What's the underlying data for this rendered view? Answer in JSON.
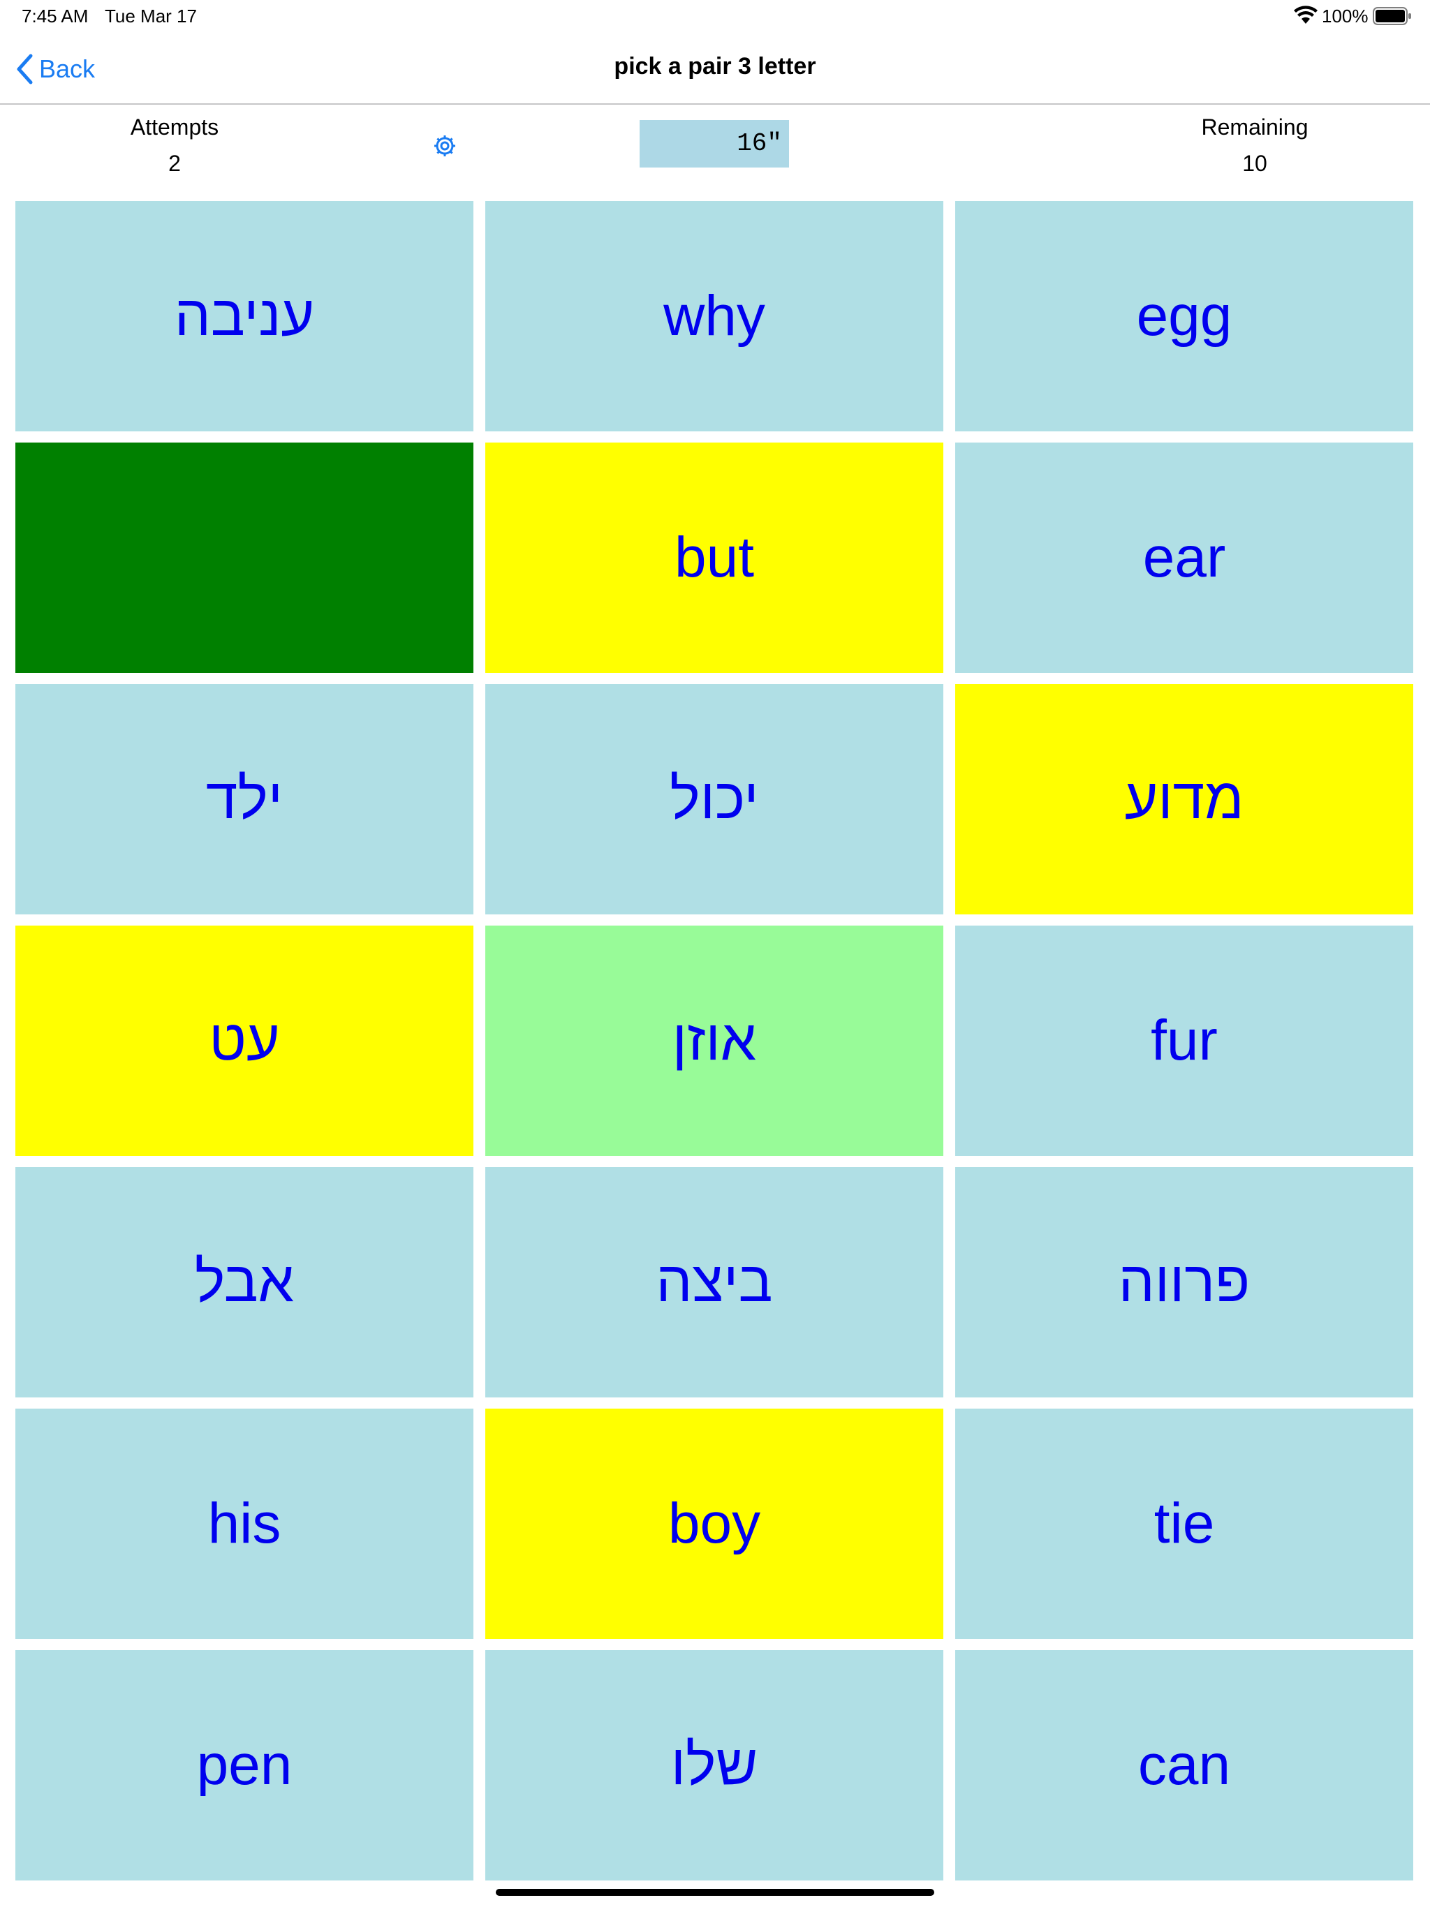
{
  "status_bar": {
    "time": "7:45 AM",
    "date": "Tue Mar 17",
    "battery": "100%"
  },
  "nav": {
    "back_label": "Back",
    "title": "pick a pair 3 letter"
  },
  "stats": {
    "attempts_label": "Attempts",
    "attempts_value": "2",
    "remaining_label": "Remaining",
    "remaining_value": "10"
  },
  "timer": "16\"",
  "colors": {
    "unselected": "#b0dfe5",
    "selected": "#ffff00",
    "matched": "#008000",
    "hint": "#98fb98",
    "text": "#0000ee",
    "accent": "#1a7cf2"
  },
  "cards": [
    {
      "text": "עניבה",
      "state": "unselected"
    },
    {
      "text": "why",
      "state": "unselected"
    },
    {
      "text": "egg",
      "state": "unselected"
    },
    {
      "text": "",
      "state": "matched"
    },
    {
      "text": "but",
      "state": "selected"
    },
    {
      "text": "ear",
      "state": "unselected"
    },
    {
      "text": "ילד",
      "state": "unselected"
    },
    {
      "text": "יכול",
      "state": "unselected"
    },
    {
      "text": "מדוע",
      "state": "selected"
    },
    {
      "text": "עט",
      "state": "selected"
    },
    {
      "text": "אוזן",
      "state": "hint"
    },
    {
      "text": "fur",
      "state": "unselected"
    },
    {
      "text": "אבל",
      "state": "unselected"
    },
    {
      "text": "ביצה",
      "state": "unselected"
    },
    {
      "text": "פרווה",
      "state": "unselected"
    },
    {
      "text": "his",
      "state": "unselected"
    },
    {
      "text": "boy",
      "state": "selected"
    },
    {
      "text": "tie",
      "state": "unselected"
    },
    {
      "text": "pen",
      "state": "unselected"
    },
    {
      "text": "שלו",
      "state": "unselected"
    },
    {
      "text": "can",
      "state": "unselected"
    }
  ]
}
